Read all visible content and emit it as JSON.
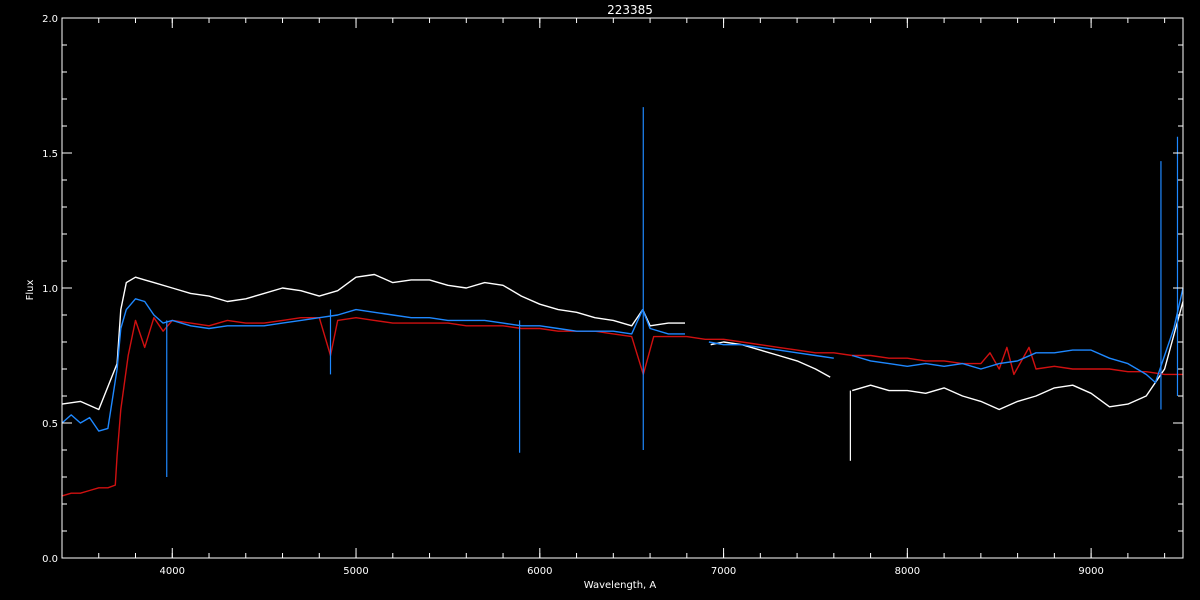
{
  "chart_data": {
    "type": "line",
    "title": "223385",
    "xlabel": "Wavelength, A",
    "ylabel": "Flux",
    "xlim": [
      3400,
      9500
    ],
    "ylim": [
      0.0,
      2.0
    ],
    "xticks": [
      4000,
      5000,
      6000,
      7000,
      8000,
      9000
    ],
    "yticks": [
      0.0,
      0.5,
      1.0,
      1.5,
      2.0
    ],
    "ytick_labels": [
      "0.0",
      "0.5",
      "1.0",
      "1.5",
      "2.0"
    ],
    "legend": "none",
    "grid": false,
    "background_color": "#000000",
    "axis_color": "#ffffff",
    "series": [
      {
        "color": "#ffffff",
        "x": [
          3400,
          3500,
          3600,
          3700,
          3720,
          3750,
          3800,
          3850,
          3900,
          4000,
          4100,
          4200,
          4300,
          4400,
          4500,
          4600,
          4700,
          4800,
          4900,
          5000,
          5100,
          5200,
          5300,
          5400,
          5500,
          5600,
          5700,
          5800,
          5900,
          6000,
          6100,
          6200,
          6300,
          6400,
          6500,
          6560,
          6600,
          6700,
          6790,
          null,
          6930,
          7000,
          7100,
          7200,
          7300,
          7400,
          7500,
          7580,
          null,
          7700,
          7800,
          7900,
          8000,
          8100,
          8200,
          8300,
          8400,
          8500,
          8600,
          8700,
          8800,
          8900,
          9000,
          9100,
          9200,
          9300,
          9400,
          9500
        ],
        "y": [
          0.57,
          0.58,
          0.55,
          0.72,
          0.92,
          1.02,
          1.04,
          1.03,
          1.02,
          1.0,
          0.98,
          0.97,
          0.95,
          0.96,
          0.98,
          1.0,
          0.99,
          0.97,
          0.99,
          1.04,
          1.05,
          1.02,
          1.03,
          1.03,
          1.01,
          1.0,
          1.02,
          1.01,
          0.97,
          0.94,
          0.92,
          0.91,
          0.89,
          0.88,
          0.86,
          0.92,
          0.86,
          0.87,
          0.87,
          null,
          0.79,
          0.8,
          0.79,
          0.77,
          0.75,
          0.73,
          0.7,
          0.67,
          null,
          0.62,
          0.64,
          0.62,
          0.62,
          0.61,
          0.63,
          0.6,
          0.58,
          0.55,
          0.58,
          0.6,
          0.63,
          0.64,
          0.61,
          0.56,
          0.57,
          0.6,
          0.7,
          0.95
        ]
      },
      {
        "color": "#d01010",
        "x": [
          3400,
          3450,
          3500,
          3550,
          3600,
          3650,
          3690,
          3700,
          3720,
          3760,
          3800,
          3850,
          3900,
          3950,
          4000,
          4100,
          4200,
          4300,
          4400,
          4500,
          4600,
          4700,
          4800,
          4861,
          4900,
          5000,
          5100,
          5200,
          5300,
          5400,
          5500,
          5600,
          5700,
          5800,
          5900,
          6000,
          6100,
          6200,
          6300,
          6400,
          6500,
          6563,
          6620,
          6700,
          6800,
          6900,
          7000,
          7100,
          7200,
          7300,
          7400,
          7500,
          7600,
          7700,
          7800,
          7900,
          8000,
          8100,
          8200,
          8300,
          8400,
          8450,
          8500,
          8542,
          8580,
          8662,
          8700,
          8800,
          8900,
          9000,
          9100,
          9200,
          9300,
          9400,
          9500
        ],
        "y": [
          0.23,
          0.24,
          0.24,
          0.25,
          0.26,
          0.26,
          0.27,
          0.38,
          0.55,
          0.75,
          0.88,
          0.78,
          0.89,
          0.84,
          0.88,
          0.87,
          0.86,
          0.88,
          0.87,
          0.87,
          0.88,
          0.89,
          0.89,
          0.75,
          0.88,
          0.89,
          0.88,
          0.87,
          0.87,
          0.87,
          0.87,
          0.86,
          0.86,
          0.86,
          0.85,
          0.85,
          0.84,
          0.84,
          0.84,
          0.83,
          0.82,
          0.68,
          0.82,
          0.82,
          0.82,
          0.81,
          0.81,
          0.8,
          0.79,
          0.78,
          0.77,
          0.76,
          0.76,
          0.75,
          0.75,
          0.74,
          0.74,
          0.73,
          0.73,
          0.72,
          0.72,
          0.76,
          0.7,
          0.78,
          0.68,
          0.78,
          0.7,
          0.71,
          0.7,
          0.7,
          0.7,
          0.69,
          0.69,
          0.68,
          0.68
        ]
      },
      {
        "color": "#1e88ff",
        "x": [
          3400,
          3450,
          3500,
          3550,
          3600,
          3650,
          3700,
          3720,
          3750,
          3800,
          3850,
          3900,
          3950,
          4000,
          4100,
          4200,
          4300,
          4400,
          4500,
          4600,
          4700,
          4800,
          4900,
          5000,
          5100,
          5200,
          5300,
          5400,
          5500,
          5600,
          5700,
          5800,
          5900,
          6000,
          6100,
          6200,
          6300,
          6400,
          6500,
          6560,
          6600,
          6700,
          6790,
          null,
          6920,
          7000,
          7100,
          7200,
          7300,
          7400,
          7500,
          7600,
          null,
          7700,
          7800,
          7900,
          8000,
          8100,
          8200,
          8300,
          8400,
          8500,
          8600,
          8700,
          8800,
          8900,
          9000,
          9100,
          9200,
          9300,
          9350,
          9400,
          9450,
          9500
        ],
        "y": [
          0.5,
          0.53,
          0.5,
          0.52,
          0.47,
          0.48,
          0.7,
          0.85,
          0.92,
          0.96,
          0.95,
          0.9,
          0.87,
          0.88,
          0.86,
          0.85,
          0.86,
          0.86,
          0.86,
          0.87,
          0.88,
          0.89,
          0.9,
          0.92,
          0.91,
          0.9,
          0.89,
          0.89,
          0.88,
          0.88,
          0.88,
          0.87,
          0.86,
          0.86,
          0.85,
          0.84,
          0.84,
          0.84,
          0.83,
          0.92,
          0.85,
          0.83,
          0.83,
          null,
          0.8,
          0.79,
          0.79,
          0.78,
          0.77,
          0.76,
          0.75,
          0.74,
          null,
          0.75,
          0.73,
          0.72,
          0.71,
          0.72,
          0.71,
          0.72,
          0.7,
          0.72,
          0.73,
          0.76,
          0.76,
          0.77,
          0.77,
          0.74,
          0.72,
          0.68,
          0.65,
          0.75,
          0.85,
          1.0
        ]
      }
    ],
    "annotations": [
      {
        "color": "#1e88ff",
        "x": 6563,
        "ymin": 0.4,
        "ymax": 1.67
      },
      {
        "color": "#1e88ff",
        "x": 4861,
        "ymin": 0.68,
        "ymax": 0.92
      },
      {
        "color": "#1e88ff",
        "x": 5890,
        "ymin": 0.39,
        "ymax": 0.88
      },
      {
        "color": "#1e88ff",
        "x": 3970,
        "ymin": 0.3,
        "ymax": 0.88
      },
      {
        "color": "#1e88ff",
        "x": 9380,
        "ymin": 0.55,
        "ymax": 1.47
      },
      {
        "color": "#1e88ff",
        "x": 9470,
        "ymin": 0.6,
        "ymax": 1.56
      },
      {
        "color": "#ffffff",
        "x": 7690,
        "ymin": 0.36,
        "ymax": 0.62
      }
    ]
  }
}
